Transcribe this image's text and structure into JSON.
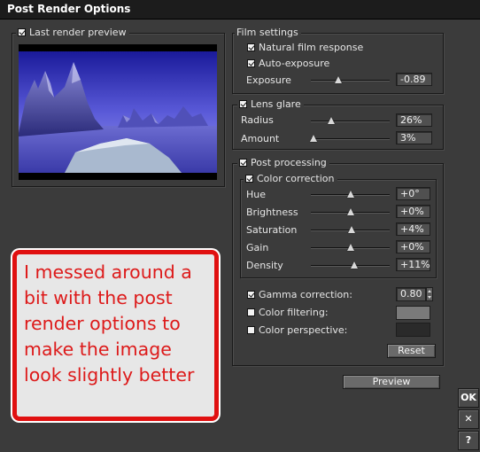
{
  "window": {
    "title": "Post Render Options"
  },
  "preview": {
    "label": "Last render preview",
    "checked": true
  },
  "film_settings": {
    "title": "Film settings",
    "natural_film_response": {
      "label": "Natural film response",
      "checked": true
    },
    "auto_exposure": {
      "label": "Auto-exposure",
      "checked": true
    },
    "exposure": {
      "label": "Exposure",
      "value": "-0.89",
      "level": 0.35
    }
  },
  "lens_glare": {
    "title": "Lens glare",
    "checked": true,
    "radius": {
      "label": "Radius",
      "value": "26%",
      "level": 0.26
    },
    "amount": {
      "label": "Amount",
      "value": "3%",
      "level": 0.03
    }
  },
  "post_processing": {
    "title": "Post processing",
    "checked": true,
    "color_correction": {
      "title": "Color correction",
      "checked": true,
      "sliders": [
        {
          "label": "Hue",
          "value": "+0°",
          "level": 0.5
        },
        {
          "label": "Brightness",
          "value": "+0%",
          "level": 0.5
        },
        {
          "label": "Saturation",
          "value": "+4%",
          "level": 0.52
        },
        {
          "label": "Gain",
          "value": "+0%",
          "level": 0.5
        },
        {
          "label": "Density",
          "value": "+11%",
          "level": 0.55
        }
      ]
    },
    "gamma_correction": {
      "label": "Gamma correction:",
      "checked": true,
      "value": "0.80"
    },
    "color_filtering": {
      "label": "Color filtering:",
      "checked": false,
      "swatch": "#7a7a7a"
    },
    "color_perspective": {
      "label": "Color perspective:",
      "checked": false,
      "swatch": "#2a2a2a"
    },
    "reset_label": "Reset"
  },
  "preview_button": "Preview",
  "side_buttons": {
    "ok": "OK",
    "cancel": "✕",
    "help": "?"
  },
  "annotation": {
    "text": "I messed around a bit with the post render options to make the image look slightly better"
  },
  "colors": {
    "annotation_border": "#e01010",
    "annotation_text": "#dd1a1a"
  }
}
